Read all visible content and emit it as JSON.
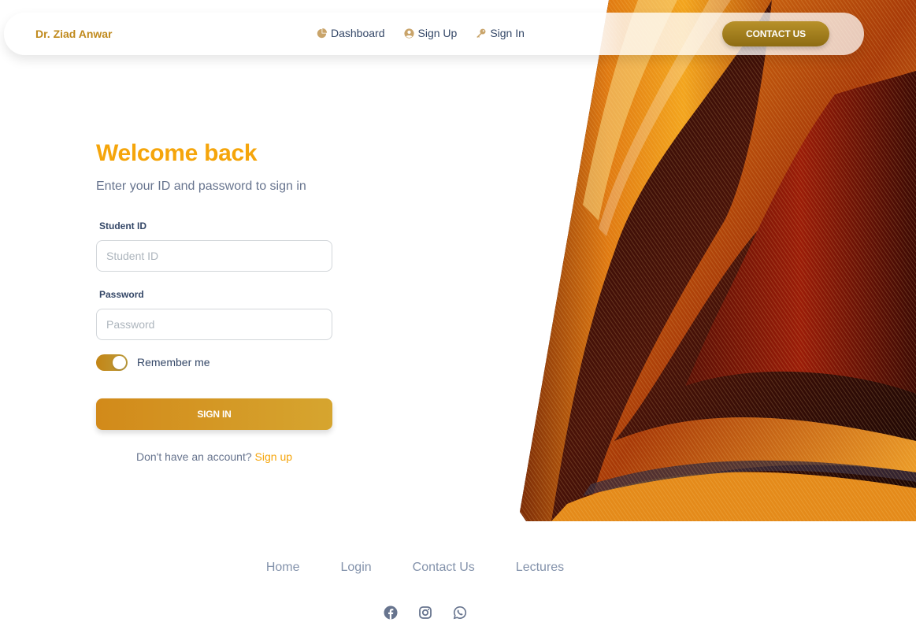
{
  "navbar": {
    "brand": "Dr. Ziad Anwar",
    "links": [
      {
        "label": "Dashboard",
        "icon": "pie-chart-icon"
      },
      {
        "label": "Sign Up",
        "icon": "user-circle-icon"
      },
      {
        "label": "Sign In",
        "icon": "key-icon"
      }
    ],
    "contact_label": "CONTACT US"
  },
  "form": {
    "title": "Welcome back",
    "subtitle": "Enter your ID and password to sign in",
    "student_id_label": "Student ID",
    "student_id_placeholder": "Student ID",
    "student_id_value": "",
    "password_label": "Password",
    "password_placeholder": "Password",
    "password_value": "",
    "remember_label": "Remember me",
    "remember_checked": true,
    "signin_label": "SIGN IN",
    "no_account_text": "Don't have an account?",
    "signup_link": "Sign up"
  },
  "footer": {
    "links": [
      "Home",
      "Login",
      "Contact Us",
      "Lectures"
    ],
    "social": [
      "facebook-icon",
      "instagram-icon",
      "whatsapp-icon"
    ]
  },
  "colors": {
    "accent": "#f5a50b",
    "brand": "#c08a1d",
    "button": "#d28a1a",
    "text_dark": "#344767",
    "text_muted": "#67748e"
  }
}
